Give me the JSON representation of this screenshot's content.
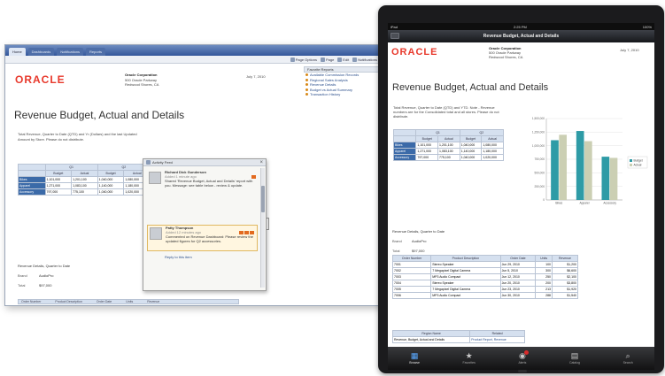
{
  "desktop": {
    "browser_tabs": [
      "Home",
      "Dashboards",
      "Notifications",
      "Reports"
    ],
    "toolbar": [
      "Page Options",
      "Page",
      "Edit",
      "Notifications"
    ],
    "report": {
      "logo": "ORACLE",
      "company_lines": [
        "Oracle Corporation",
        "500 Oracle Parkway",
        "Redwood Shores, CA"
      ],
      "date": "July 7, 2010",
      "title": "Revenue Budget, Actual and Details",
      "intro_text": "Total Revenue, Quarter to Date (QTD) and Yr (Dollars) and the last Updated Amount by Store. Please do not distribute.",
      "table": {
        "group_headers": [
          "Q1",
          "Q2"
        ],
        "headers": [
          "",
          "Budget",
          "Actual",
          "Budget",
          "Actual"
        ],
        "rows": [
          [
            "Bikes",
            "1,101,000",
            "1,201,100",
            "1,040,000",
            "1,080,000"
          ],
          [
            "Apparel",
            "1,271,000",
            "1,083,100",
            "1,140,000",
            "1,180,000"
          ],
          [
            "Accessory",
            "797,000",
            "775,100",
            "1,040,000",
            "1,020,000"
          ]
        ]
      },
      "details_title": "Revenue Details, Quarter to Date",
      "details": [
        {
          "label": "Brand",
          "value": "AudioPro"
        },
        {
          "label": "Total",
          "value": "$97,000"
        }
      ],
      "footer_columns": [
        "Order Number",
        "Product Description",
        "Order Date",
        "Units",
        "Revenue"
      ]
    },
    "right_panel": {
      "header": "Favorite Reports",
      "links": [
        "Available Commission Records",
        "Regional Sales Analysis",
        "Revenue Details",
        "Budget vs Actual Summary",
        "Transaction History"
      ]
    },
    "popup": {
      "title": "Activity Feed",
      "items": [
        {
          "name": "Richard Dick Gunderson",
          "meta": "Added 1 minute ago",
          "text": "Shared 'Revenue Budget, Actual and Details' report with you. Message: see table below - review & update."
        },
        {
          "name": "Patty Thompson",
          "meta": "Added 12 minutes ago",
          "text": "Commented on Revenue Dashboard: Please review the updated figures for Q2 accessories.",
          "action": "Reply to this item"
        }
      ]
    }
  },
  "ipad": {
    "status": {
      "carrier": "iPad",
      "time": "2:25 PM",
      "battery": "100%"
    },
    "nav_title": "Revenue Budget, Actual and Details",
    "report": {
      "logo": "ORACLE",
      "company_lines": [
        "Oracle Corporation",
        "500 Oracle Parkway",
        "Redwood Shores, CA"
      ],
      "date": "July 7, 2010",
      "title": "Revenue Budget, Actual and Details",
      "intro_text": "Total Revenue, Quarter to Date (QTD) and YTD. Note - Revenue numbers are for the Consolidated total and all stores. Please do not distribute.",
      "table": {
        "group_headers": [
          "Q1",
          "Q2"
        ],
        "headers": [
          "",
          "Budget",
          "Actual",
          "Budget",
          "Actual"
        ],
        "rows": [
          [
            "Bikes",
            "1,101,000",
            "1,201,100",
            "1,040,000",
            "1,080,000"
          ],
          [
            "Apparel",
            "1,271,000",
            "1,083,100",
            "1,140,000",
            "1,180,000"
          ],
          [
            "Accessory",
            "797,000",
            "775,100",
            "1,040,000",
            "1,020,000"
          ]
        ]
      },
      "details_title": "Revenue Details, Quarter to Date",
      "details": [
        {
          "label": "Brand",
          "value": "AudioPro"
        },
        {
          "label": "Total",
          "value": "$97,000"
        }
      ],
      "orders": {
        "headers": [
          "Order Number",
          "Product Description",
          "Order Date",
          "Units",
          "Revenue"
        ],
        "rows": [
          [
            "7001",
            "Stereo Speaker",
            "Jun 29, 2010",
            "100",
            "$1,200"
          ],
          [
            "7002",
            "7 Megapixel Digital Camera",
            "Jun 5, 2010",
            "300",
            "$6,600"
          ],
          [
            "7003",
            "MP3 Audio Compact",
            "Jun 12, 2010",
            "250",
            "$2,100"
          ],
          [
            "7004",
            "Stereo Speaker",
            "Jun 20, 2010",
            "200",
            "$3,800"
          ],
          [
            "7005",
            "7 Megapixel Digital Camera",
            "Jun 23, 2010",
            "213",
            "$1,920"
          ],
          [
            "7006",
            "MP3 Audio Compact",
            "Jun 30, 2010",
            "288",
            "$1,540"
          ]
        ]
      },
      "related": {
        "headers": [
          "Region Name",
          "Related"
        ],
        "rows": [
          [
            "Revenue, Budget, Actual and Details",
            "Product Report, Revenue"
          ]
        ]
      }
    },
    "tabs": [
      {
        "label": "Browse",
        "icon": "browse-icon",
        "glyph": "▦"
      },
      {
        "label": "Favorites",
        "icon": "favorites-icon",
        "glyph": "★"
      },
      {
        "label": "Alerts",
        "icon": "alerts-icon",
        "glyph": "◉"
      },
      {
        "label": "Catalog",
        "icon": "catalog-icon",
        "glyph": "▤"
      },
      {
        "label": "Search",
        "icon": "search-icon",
        "glyph": "⌕"
      }
    ]
  },
  "chart_data": {
    "type": "bar",
    "categories": [
      "Bikes",
      "Apparel",
      "Accessory"
    ],
    "series": [
      {
        "name": "Budget",
        "values": [
          1101000,
          1271000,
          797000
        ],
        "color": "#2e9ba6"
      },
      {
        "name": "Actual",
        "values": [
          1201100,
          1083100,
          775100
        ],
        "color": "#cbcfb3"
      }
    ],
    "title": "",
    "xlabel": "",
    "ylabel": "",
    "ylim": [
      0,
      1500000
    ],
    "yticks": [
      "1,500,000",
      "1,250,000",
      "1,000,000",
      "750,000",
      "500,000",
      "250,000",
      "0"
    ],
    "grid": true,
    "legend": "right"
  },
  "colors": {
    "oracle_red": "#e8392c",
    "header_blue": "#3b6aa8",
    "teal": "#2e9ba6",
    "khaki": "#cbcfb3"
  }
}
